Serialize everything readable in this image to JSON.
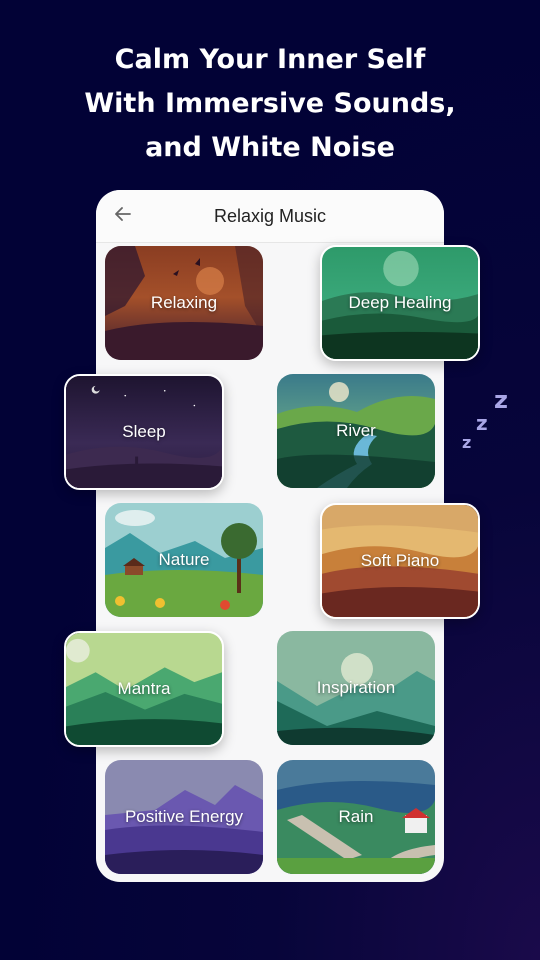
{
  "headline": {
    "lines": [
      "Calm Your Inner Self",
      "With Immersive Sounds,",
      "and White Noise"
    ]
  },
  "app": {
    "title": "Relaxig Music",
    "back_icon": "arrow-left-icon"
  },
  "categories": [
    {
      "label": "Relaxing",
      "theme": "sunset-forest",
      "highlighted": false
    },
    {
      "label": "Deep Healing",
      "theme": "green-mountains",
      "highlighted": true
    },
    {
      "label": "Sleep",
      "theme": "night-desert",
      "highlighted": true
    },
    {
      "label": "River",
      "theme": "forest-river",
      "highlighted": false
    },
    {
      "label": "Nature",
      "theme": "meadow-cabin",
      "highlighted": false
    },
    {
      "label": "Soft Piano",
      "theme": "amber-hills",
      "highlighted": true
    },
    {
      "label": "Mantra",
      "theme": "green-peaks",
      "highlighted": true
    },
    {
      "label": "Inspiration",
      "theme": "teal-valley",
      "highlighted": false
    },
    {
      "label": "Positive Energy",
      "theme": "purple-mountains",
      "highlighted": false
    },
    {
      "label": "Rain",
      "theme": "windmill-village",
      "highlighted": false
    }
  ],
  "decor": {
    "sleep_icon": "zzz-icon",
    "sleep_icon_color": "#a9a6e6"
  },
  "colors": {
    "background": "#020236",
    "panel": "#f7f7f8",
    "text_light": "#ffffff"
  }
}
